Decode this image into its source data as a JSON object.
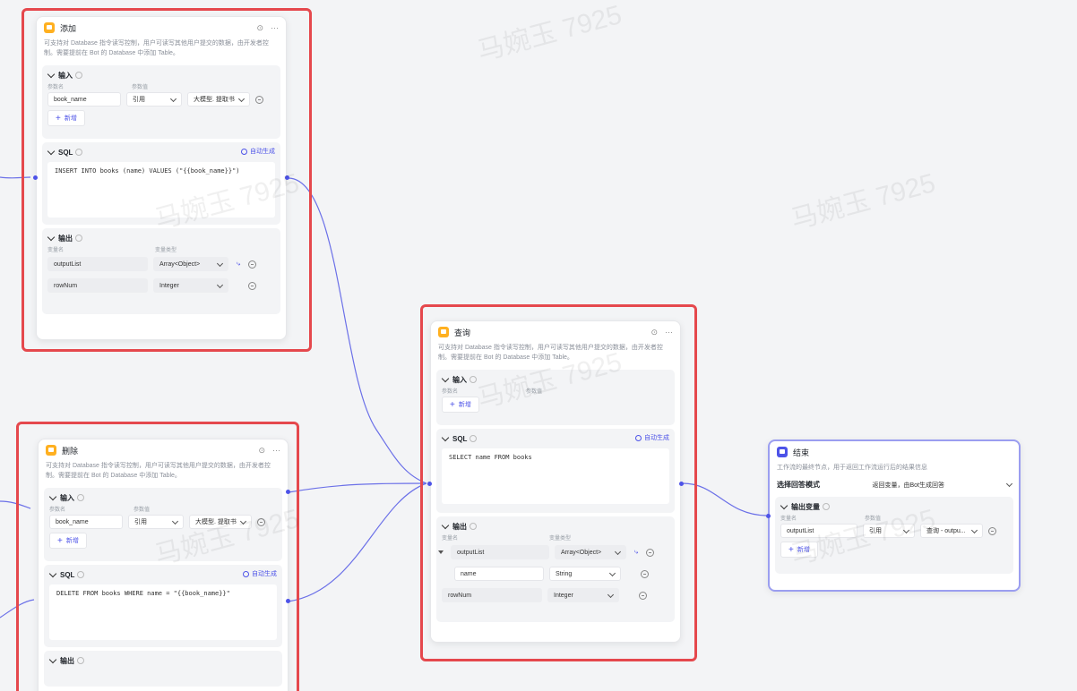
{
  "watermark": "马婉玉 7925",
  "colors": {
    "accent": "#4d53e8",
    "highlight": "#e5484d",
    "db_icon": "#ffb020"
  },
  "common": {
    "desc": "可支持对 Database 指令读写控制，用户可读写其他用户提交的数据，由开发者控制。需要提前在 Bot 的 Database 中添加 Table。",
    "input_label": "输入",
    "output_label": "输出",
    "sql_label": "SQL",
    "auto_generate": "自动生成",
    "param_name": "参数名",
    "param_value": "参数值",
    "var_name": "变量名",
    "var_type": "变量类型",
    "add": "新增",
    "ref": "引用"
  },
  "node_add": {
    "title": "添加",
    "input": {
      "name": "book_name",
      "source": "大模型. 提取书"
    },
    "sql": "INSERT INTO books (name) VALUES (\"{{book_name}}\")",
    "outputs": [
      {
        "name": "outputList",
        "type": "Array<Object>"
      },
      {
        "name": "rowNum",
        "type": "Integer"
      }
    ]
  },
  "node_delete": {
    "title": "删除",
    "input": {
      "name": "book_name",
      "source": "大模型. 提取书"
    },
    "sql": "DELETE FROM books WHERE name = \"{{book_name}}\""
  },
  "node_query": {
    "title": "查询",
    "sql": "SELECT name FROM books",
    "outputs": [
      {
        "name": "outputList",
        "type": "Array<Object>"
      },
      {
        "name": "name",
        "type": "String"
      },
      {
        "name": "rowNum",
        "type": "Integer"
      }
    ]
  },
  "node_end": {
    "title": "结束",
    "desc": "工作流的最终节点，用于返回工作流运行后的结果信息",
    "mode_label": "选择回答模式",
    "mode_value": "返回变量，由Bot生成回答",
    "output_var_label": "输出变量",
    "var": {
      "name": "outputList",
      "source": "查询 - outpu..."
    }
  }
}
